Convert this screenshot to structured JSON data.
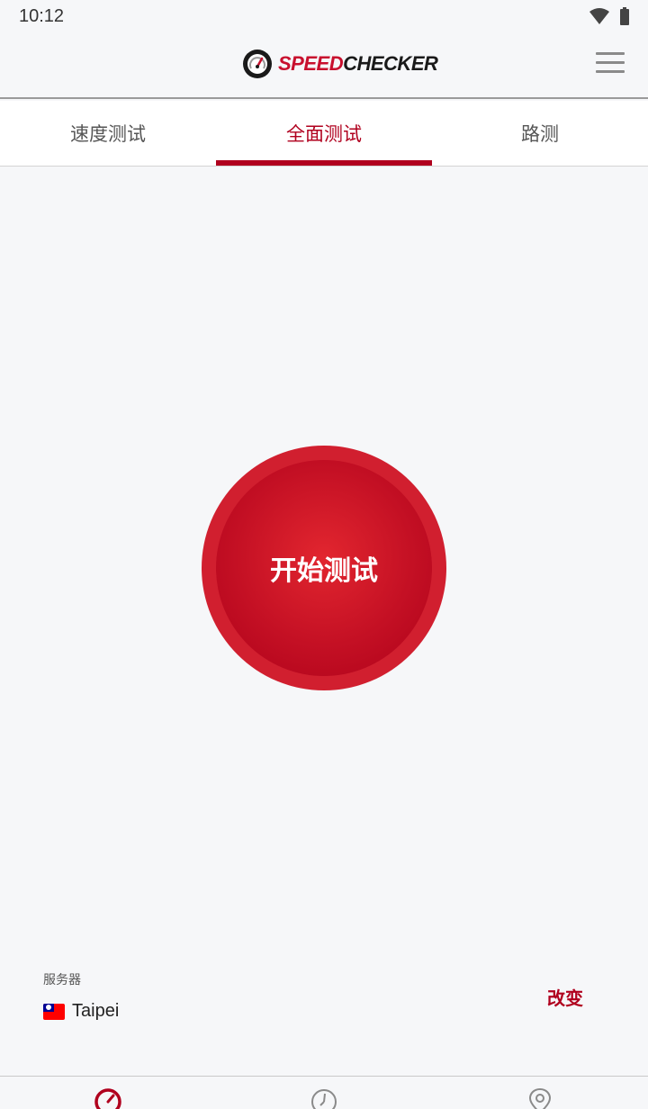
{
  "status_bar": {
    "time": "10:12",
    "icons": [
      "wifi-icon",
      "battery-icon"
    ]
  },
  "header": {
    "logo": {
      "part1": "SPEED",
      "part2": "CHECKER"
    },
    "menu_icon": "hamburger-menu-icon"
  },
  "tabs": [
    {
      "label": "速度测试",
      "active": false
    },
    {
      "label": "全面测试",
      "active": true
    },
    {
      "label": "路测",
      "active": false
    }
  ],
  "main": {
    "start_button_label": "开始测试"
  },
  "server": {
    "caption": "服务器",
    "name": "Taipei",
    "change_label": "改变"
  },
  "bottom_nav": {
    "icons": [
      "speedometer-icon",
      "history-clock-icon",
      "map-pin-icon"
    ],
    "active_index": 0
  },
  "colors": {
    "accent": "#b0001e",
    "button_red": "#d11f2f",
    "background": "#f6f7f9"
  }
}
